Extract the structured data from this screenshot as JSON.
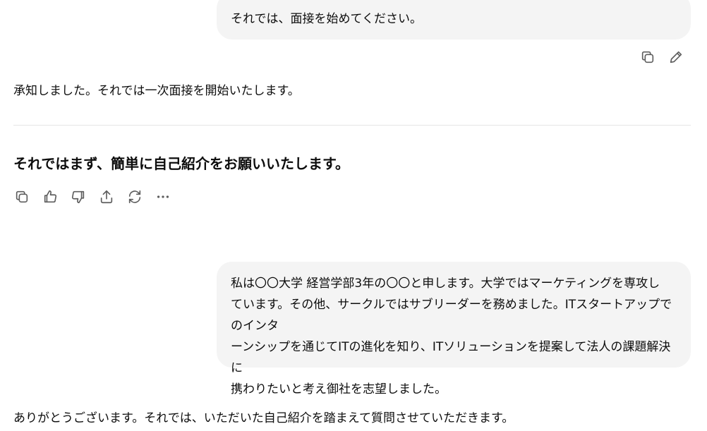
{
  "messages": {
    "user_1": "それでは、面接を始めてください。",
    "assistant_ack": "承知しました。それでは一次面接を開始いたします。",
    "assistant_question": "それではまず、簡単に自己紹介をお願いいたします。",
    "user_2_lines": [
      "私は〇〇大学 経営学部3年の〇〇と申します。大学ではマーケティングを専攻し",
      "ています。その他、サークルではサブリーダーを務めました。ITスタートアップでのインタ",
      "ーンシップを通じてITの進化を知り、ITソリューションを提案して法人の課題解決に",
      "携わりたいと考え御社を志望しました。"
    ],
    "assistant_followup": "ありがとうございます。それでは、いただいた自己紹介を踏まえて質問させていただきます。"
  },
  "icons": {
    "user_actions": [
      "copy-icon",
      "edit-icon"
    ],
    "assistant_actions": [
      "copy-icon",
      "thumbs-up-icon",
      "thumbs-down-icon",
      "share-icon",
      "regenerate-icon",
      "more-icon"
    ]
  }
}
